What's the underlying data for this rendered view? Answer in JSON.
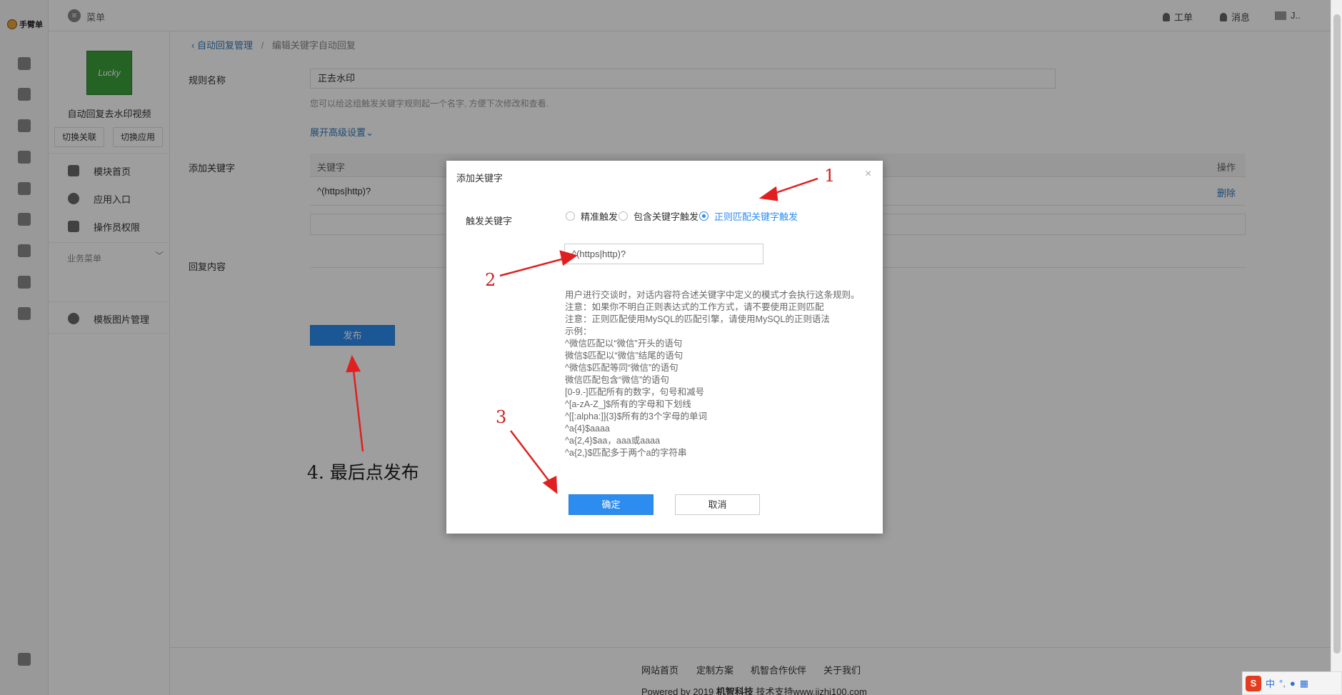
{
  "rail": {
    "logo_text": "手臂单"
  },
  "topbar": {
    "menu_label": "菜单",
    "work_order": "工单",
    "messages": "消息",
    "user": "J.."
  },
  "sidebar": {
    "avatar_text": "Lucky",
    "app_name": "自动回复去水印视频",
    "switch_account": "切换关联",
    "switch_app": "切换应用",
    "items": [
      {
        "label": "模块首页",
        "icon": "home-icon"
      },
      {
        "label": "应用入口",
        "icon": "chat-icon"
      },
      {
        "label": "操作员权限",
        "icon": "edit-icon"
      }
    ],
    "group_label": "业务菜单",
    "group_items": [
      {
        "label": "模板图片管理",
        "icon": "gear-icon"
      }
    ]
  },
  "breadcrumb": {
    "parent": "自动回复管理",
    "separator": "/",
    "current": "编辑关键字自动回复"
  },
  "form": {
    "rule_name_label": "规则名称",
    "rule_name_value": "正去水印",
    "rule_name_help": "您可以给这组触发关键字规则起一个名字, 方便下次修改和查看.",
    "advanced": "展开高级设置",
    "add_keyword_label": "添加关键字",
    "table_header_keyword": "关键字",
    "table_header_action": "操作",
    "keyword_row_value": "^(https|http)?",
    "keyword_row_action": "删除",
    "reply_label": "回复内容",
    "publish": "发布"
  },
  "footer": {
    "links": [
      "网站首页",
      "定制方案",
      "机智合作伙伴",
      "关于我们"
    ],
    "powered_prefix": "Powered by 2019",
    "powered_brand": "机智科技",
    "powered_suffix": "技术支持www.jizhi100.com"
  },
  "modal": {
    "title": "添加关键字",
    "close": "×",
    "trigger_label": "触发关键字",
    "options": [
      "精准触发",
      "包含关键字触发",
      "正则匹配关键字触发"
    ],
    "selected_option": "正则匹配关键字触发",
    "input_value": "^(https|http)?",
    "help_lines": [
      "用户进行交谈时，对话内容符合述关键字中定义的模式才会执行这条规则。",
      "注意：如果你不明白正则表达式的工作方式，请不要使用正则匹配",
      "注意：正则匹配使用MySQL的匹配引擎，请使用MySQL的正则语法",
      "示例：",
      "^微信匹配以“微信”开头的语句",
      "微信$匹配以“微信”结尾的语句",
      "^微信$匹配等同“微信”的语句",
      "微信匹配包含“微信”的语句",
      "[0-9.-]匹配所有的数字，句号和减号",
      "^[a-zA-Z_]$所有的字母和下划线",
      "^[[:alpha:]]{3}$所有的3个字母的单词",
      "^a{4}$aaaa",
      "^a{2,4}$aa，aaa或aaaa",
      "^a{2,}$匹配多于两个a的字符串"
    ],
    "ok": "确定",
    "cancel": "取消"
  },
  "annotations": {
    "n1": "1",
    "n2": "2",
    "n3": "3",
    "final": "4. 最后点发布",
    "arrow_color": "#e02020"
  },
  "ime": {
    "logo": "S",
    "mode": "中",
    "punct": "°,"
  }
}
